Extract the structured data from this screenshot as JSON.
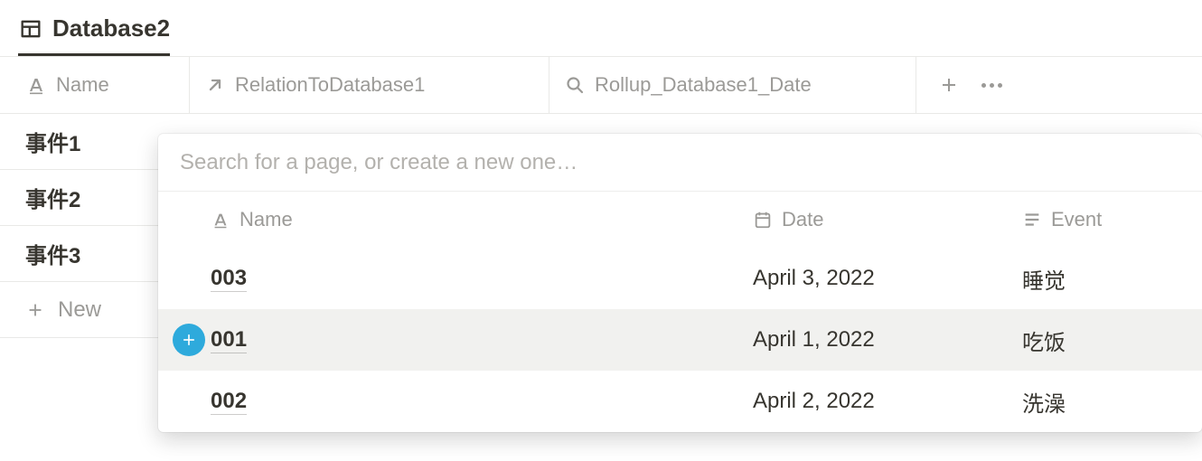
{
  "tab": {
    "title": "Database2"
  },
  "columns": {
    "name": "Name",
    "relation": "RelationToDatabase1",
    "rollup": "Rollup_Database1_Date"
  },
  "rows": [
    {
      "title": "事件1"
    },
    {
      "title": "事件2"
    },
    {
      "title": "事件3"
    }
  ],
  "new_row": {
    "label": "New"
  },
  "popup": {
    "search_placeholder": "Search for a page, or create a new one…",
    "headers": {
      "name": "Name",
      "date": "Date",
      "event": "Event"
    },
    "items": [
      {
        "name": "003",
        "date": "April 3, 2022",
        "event": "睡觉",
        "highlight": false,
        "lead_plus": false
      },
      {
        "name": "001",
        "date": "April 1, 2022",
        "event": "吃饭",
        "highlight": true,
        "lead_plus": true
      },
      {
        "name": "002",
        "date": "April 2, 2022",
        "event": "洗澡",
        "highlight": false,
        "lead_plus": false
      }
    ]
  }
}
